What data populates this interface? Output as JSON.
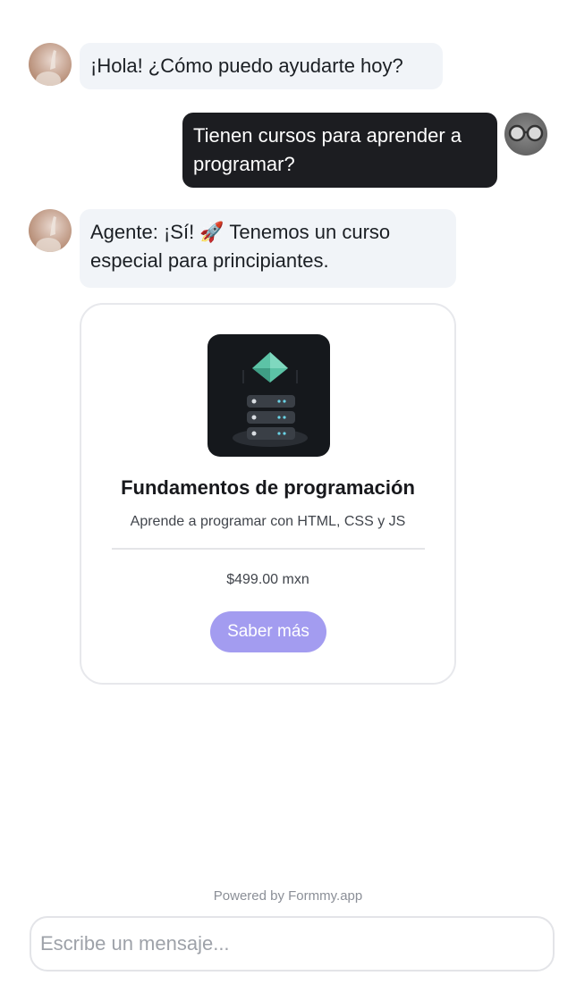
{
  "messages": [
    {
      "role": "agent",
      "text": "¡Hola! ¿Cómo puedo ayudarte hoy?"
    },
    {
      "role": "user",
      "text": "Tienen cursos para aprender a programar?"
    },
    {
      "role": "agent",
      "text": "Agente: ¡Sí! 🚀 Tenemos un curso especial para principiantes."
    }
  ],
  "product_card": {
    "title": "Fundamentos de programación",
    "subtitle": "Aprende a programar con HTML, CSS y JS",
    "price": "$499.00 mxn",
    "button_label": "Saber más"
  },
  "footer": {
    "powered_by": "Powered by Formmy.app"
  },
  "composer": {
    "placeholder": "Escribe un mensaje..."
  },
  "colors": {
    "agent_bubble": "#f1f4f8",
    "user_bubble": "#1c1d21",
    "button": "#a39cf0",
    "card_border": "#e7e8ec"
  }
}
